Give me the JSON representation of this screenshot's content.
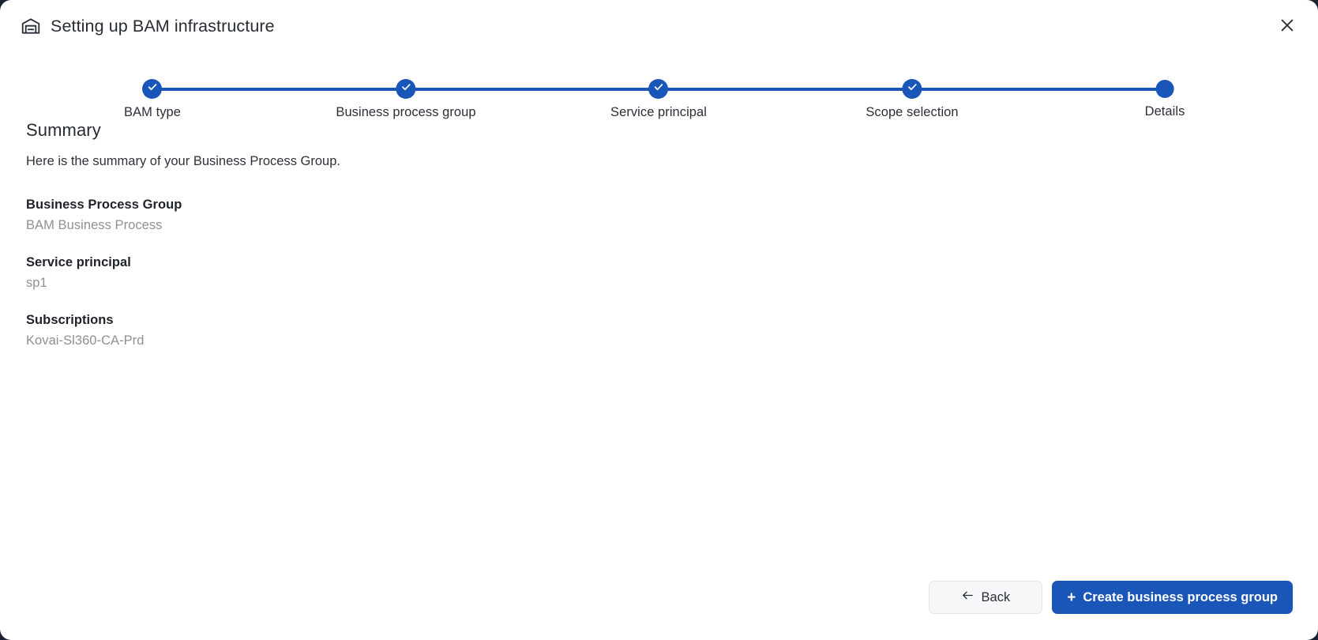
{
  "window": {
    "title": "Setting up BAM infrastructure",
    "icon": "warehouse-icon",
    "close_icon": "close-icon"
  },
  "stepper": {
    "accent_color": "#1a56b8",
    "steps": [
      {
        "label": "BAM type",
        "state": "completed",
        "icon": "check-icon"
      },
      {
        "label": "Business process group",
        "state": "completed",
        "icon": "check-icon"
      },
      {
        "label": "Service principal",
        "state": "completed",
        "icon": "check-icon"
      },
      {
        "label": "Scope selection",
        "state": "completed",
        "icon": "check-icon"
      },
      {
        "label": "Details",
        "state": "current",
        "icon": ""
      }
    ]
  },
  "main": {
    "heading": "Summary",
    "description": "Here is the summary of your Business Process Group.",
    "fields": [
      {
        "label": "Business Process Group",
        "value": "BAM Business Process"
      },
      {
        "label": "Service principal",
        "value": "sp1"
      },
      {
        "label": "Subscriptions",
        "value": "Kovai-Sl360-CA-Prd"
      }
    ]
  },
  "footer": {
    "back_label": "Back",
    "back_icon": "arrow-left-icon",
    "create_label": "Create business process group",
    "create_icon": "plus-icon",
    "primary_color": "#1a56b8"
  }
}
